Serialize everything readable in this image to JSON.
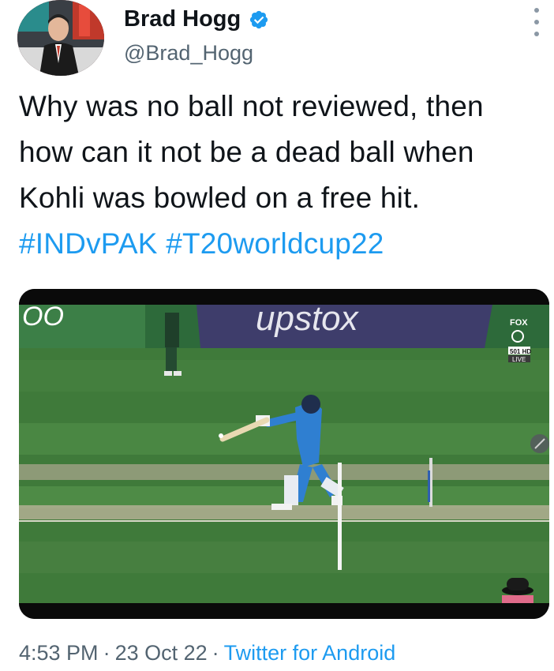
{
  "author": {
    "display_name": "Brad Hogg",
    "handle": "@Brad_Hogg",
    "verified": true,
    "verified_color": "#1d9bf0"
  },
  "tweet": {
    "text_plain": "Why was no ball not reviewed, then how can it not be a dead ball when Kohli was bowled on a free hit.",
    "hashtags": [
      "#INDvPAK",
      "#T20worldcup22"
    ],
    "hashtag_color": "#1d9bf0"
  },
  "media": {
    "ad_board_text": "upstox",
    "ad_board_partial": "OO",
    "broadcaster_logo": "FOX",
    "broadcaster_channel": "501 HD",
    "broadcaster_live": "LIVE"
  },
  "footer": {
    "time": "4:53 PM",
    "date": "23 Oct 22",
    "separator": "·",
    "source": "Twitter for Android"
  },
  "icons": [
    "verified-badge-icon",
    "more-options-icon"
  ]
}
